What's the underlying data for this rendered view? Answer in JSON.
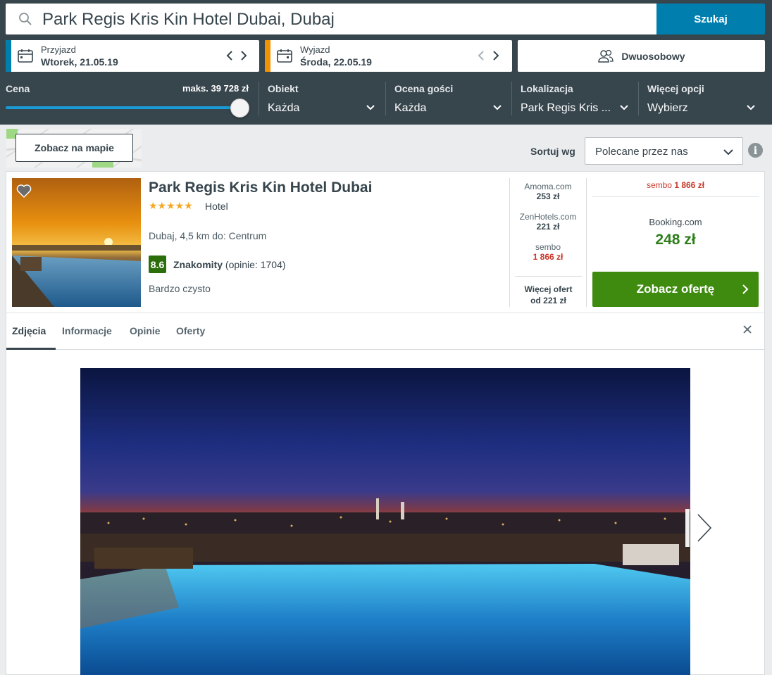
{
  "search": {
    "query": "Park Regis Kris Kin Hotel Dubai, Dubaj",
    "button": "Szukaj"
  },
  "checkin": {
    "label": "Przyjazd",
    "value": "Wtorek, 21.05.19"
  },
  "checkout": {
    "label": "Wyjazd",
    "value": "Środa, 22.05.19"
  },
  "room": {
    "value": "Dwuosobowy"
  },
  "filters": {
    "price": {
      "label": "Cena",
      "max": "maks. 39 728 zł",
      "level": 1.0
    },
    "property": {
      "label": "Obiekt",
      "value": "Każda"
    },
    "rating": {
      "label": "Ocena gości",
      "value": "Każda"
    },
    "location": {
      "label": "Lokalizacja",
      "value": "Park Regis Kris ..."
    },
    "more": {
      "label": "Więcej opcji",
      "value": "Wybierz"
    }
  },
  "map": {
    "button": "Zobacz na mapie"
  },
  "sort": {
    "label": "Sortuj wg",
    "value": "Polecane przez nas",
    "info": "i"
  },
  "hotel": {
    "name": "Park Regis Kris Kin Hotel Dubai",
    "stars": "★★★★★",
    "type": "Hotel",
    "location": "Dubaj, 4,5 km do: Centrum",
    "score": "8.6",
    "rating_word": "Znakomity",
    "reviews": "(opinie: 1704)",
    "highlight": "Bardzo czysto"
  },
  "offers": [
    {
      "provider": "Amoma.com",
      "price": "253 zł"
    },
    {
      "provider": "ZenHotels.com",
      "price": "221 zł"
    },
    {
      "provider": "sembo",
      "price": "1 866 zł"
    }
  ],
  "more_offers": {
    "line1": "Więcej ofert",
    "line2": "od 221 zł"
  },
  "top_deal": {
    "provider": "sembo",
    "price": "1 866 zł"
  },
  "best": {
    "provider": "Booking.com",
    "price": "248 zł",
    "button": "Zobacz ofertę"
  },
  "tabs": [
    {
      "label": "Zdjęcia"
    },
    {
      "label": "Informacje"
    },
    {
      "label": "Opinie"
    },
    {
      "label": "Oferty"
    }
  ],
  "colors": {
    "header": "#37454d",
    "search_button": "#007faf",
    "checkin_accent": "#007faf",
    "checkout_accent": "#f39200",
    "deal_button": "#3f8b0f",
    "price_green": "#2e7e1c",
    "price_red": "#c7372a",
    "score_bg": "#2d6e0c"
  }
}
